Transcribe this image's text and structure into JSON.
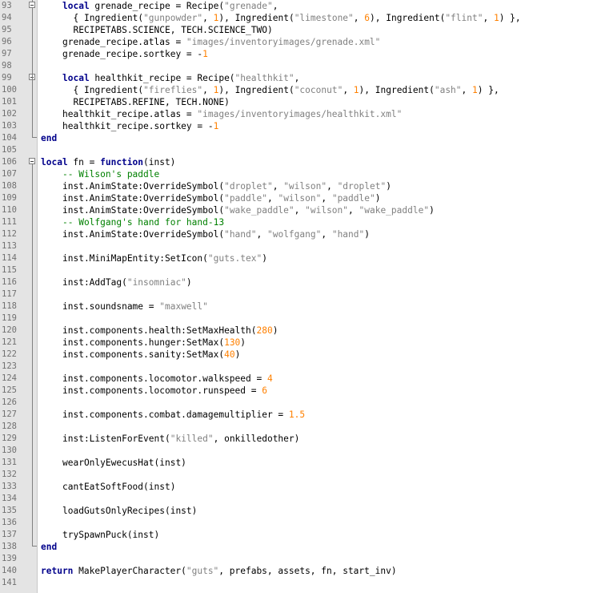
{
  "editor": {
    "colors": {
      "background": "#ffffff",
      "gutter": "#e4e4e4",
      "keyword": "#00008b",
      "string": "#808080",
      "number": "#ff8000",
      "comment": "#008000",
      "line_number": "#707070"
    },
    "fold_markers": [
      {
        "line": 93,
        "type": "start"
      },
      {
        "line": 99,
        "type": "start"
      },
      {
        "line": 104,
        "type": "end"
      },
      {
        "line": 106,
        "type": "start"
      },
      {
        "line": 138,
        "type": "end"
      }
    ],
    "lines": [
      {
        "n": "93",
        "tokens": [
          {
            "t": "kw",
            "v": "local"
          },
          {
            "t": "plain",
            "v": " grenade_recipe = Recipe("
          },
          {
            "t": "str",
            "v": "\"grenade\""
          },
          {
            "t": "plain",
            "v": ","
          }
        ],
        "indent": 2
      },
      {
        "n": "94",
        "tokens": [
          {
            "t": "plain",
            "v": "{ Ingredient("
          },
          {
            "t": "str",
            "v": "\"gunpowder\""
          },
          {
            "t": "plain",
            "v": ", "
          },
          {
            "t": "num",
            "v": "1"
          },
          {
            "t": "plain",
            "v": "), Ingredient("
          },
          {
            "t": "str",
            "v": "\"limestone\""
          },
          {
            "t": "plain",
            "v": ", "
          },
          {
            "t": "num",
            "v": "6"
          },
          {
            "t": "plain",
            "v": "), Ingredient("
          },
          {
            "t": "str",
            "v": "\"flint\""
          },
          {
            "t": "plain",
            "v": ", "
          },
          {
            "t": "num",
            "v": "1"
          },
          {
            "t": "plain",
            "v": ") },"
          }
        ],
        "indent": 3
      },
      {
        "n": "95",
        "tokens": [
          {
            "t": "plain",
            "v": "RECIPETABS.SCIENCE, TECH.SCIENCE_TWO)"
          }
        ],
        "indent": 3
      },
      {
        "n": "96",
        "tokens": [
          {
            "t": "plain",
            "v": "grenade_recipe.atlas = "
          },
          {
            "t": "str",
            "v": "\"images/inventoryimages/grenade.xml\""
          }
        ],
        "indent": 2
      },
      {
        "n": "97",
        "tokens": [
          {
            "t": "plain",
            "v": "grenade_recipe.sortkey = -"
          },
          {
            "t": "num",
            "v": "1"
          }
        ],
        "indent": 2
      },
      {
        "n": "98",
        "tokens": [],
        "indent": 0
      },
      {
        "n": "99",
        "tokens": [
          {
            "t": "kw",
            "v": "local"
          },
          {
            "t": "plain",
            "v": " healthkit_recipe = Recipe("
          },
          {
            "t": "str",
            "v": "\"healthkit\""
          },
          {
            "t": "plain",
            "v": ","
          }
        ],
        "indent": 2
      },
      {
        "n": "100",
        "tokens": [
          {
            "t": "plain",
            "v": "{ Ingredient("
          },
          {
            "t": "str",
            "v": "\"fireflies\""
          },
          {
            "t": "plain",
            "v": ", "
          },
          {
            "t": "num",
            "v": "1"
          },
          {
            "t": "plain",
            "v": "), Ingredient("
          },
          {
            "t": "str",
            "v": "\"coconut\""
          },
          {
            "t": "plain",
            "v": ", "
          },
          {
            "t": "num",
            "v": "1"
          },
          {
            "t": "plain",
            "v": "), Ingredient("
          },
          {
            "t": "str",
            "v": "\"ash\""
          },
          {
            "t": "plain",
            "v": ", "
          },
          {
            "t": "num",
            "v": "1"
          },
          {
            "t": "plain",
            "v": ") },"
          }
        ],
        "indent": 3
      },
      {
        "n": "101",
        "tokens": [
          {
            "t": "plain",
            "v": "RECIPETABS.REFINE, TECH.NONE)"
          }
        ],
        "indent": 3
      },
      {
        "n": "102",
        "tokens": [
          {
            "t": "plain",
            "v": "healthkit_recipe.atlas = "
          },
          {
            "t": "str",
            "v": "\"images/inventoryimages/healthkit.xml\""
          }
        ],
        "indent": 2
      },
      {
        "n": "103",
        "tokens": [
          {
            "t": "plain",
            "v": "healthkit_recipe.sortkey = -"
          },
          {
            "t": "num",
            "v": "1"
          }
        ],
        "indent": 2
      },
      {
        "n": "104",
        "tokens": [
          {
            "t": "kw",
            "v": "end"
          }
        ],
        "indent": 0
      },
      {
        "n": "105",
        "tokens": [],
        "indent": 0
      },
      {
        "n": "106",
        "tokens": [
          {
            "t": "kw",
            "v": "local"
          },
          {
            "t": "plain",
            "v": " fn = "
          },
          {
            "t": "kw",
            "v": "function"
          },
          {
            "t": "plain",
            "v": "(inst)"
          }
        ],
        "indent": 0
      },
      {
        "n": "107",
        "tokens": [
          {
            "t": "com",
            "v": "-- Wilson's paddle"
          }
        ],
        "indent": 2
      },
      {
        "n": "108",
        "tokens": [
          {
            "t": "plain",
            "v": "inst.AnimState:OverrideSymbol("
          },
          {
            "t": "str",
            "v": "\"droplet\""
          },
          {
            "t": "plain",
            "v": ", "
          },
          {
            "t": "str",
            "v": "\"wilson\""
          },
          {
            "t": "plain",
            "v": ", "
          },
          {
            "t": "str",
            "v": "\"droplet\""
          },
          {
            "t": "plain",
            "v": ")"
          }
        ],
        "indent": 2
      },
      {
        "n": "109",
        "tokens": [
          {
            "t": "plain",
            "v": "inst.AnimState:OverrideSymbol("
          },
          {
            "t": "str",
            "v": "\"paddle\""
          },
          {
            "t": "plain",
            "v": ", "
          },
          {
            "t": "str",
            "v": "\"wilson\""
          },
          {
            "t": "plain",
            "v": ", "
          },
          {
            "t": "str",
            "v": "\"paddle\""
          },
          {
            "t": "plain",
            "v": ")"
          }
        ],
        "indent": 2
      },
      {
        "n": "110",
        "tokens": [
          {
            "t": "plain",
            "v": "inst.AnimState:OverrideSymbol("
          },
          {
            "t": "str",
            "v": "\"wake_paddle\""
          },
          {
            "t": "plain",
            "v": ", "
          },
          {
            "t": "str",
            "v": "\"wilson\""
          },
          {
            "t": "plain",
            "v": ", "
          },
          {
            "t": "str",
            "v": "\"wake_paddle\""
          },
          {
            "t": "plain",
            "v": ")"
          }
        ],
        "indent": 2
      },
      {
        "n": "111",
        "tokens": [
          {
            "t": "com",
            "v": "-- Wolfgang's hand for hand-13"
          }
        ],
        "indent": 2
      },
      {
        "n": "112",
        "tokens": [
          {
            "t": "plain",
            "v": "inst.AnimState:OverrideSymbol("
          },
          {
            "t": "str",
            "v": "\"hand\""
          },
          {
            "t": "plain",
            "v": ", "
          },
          {
            "t": "str",
            "v": "\"wolfgang\""
          },
          {
            "t": "plain",
            "v": ", "
          },
          {
            "t": "str",
            "v": "\"hand\""
          },
          {
            "t": "plain",
            "v": ")"
          }
        ],
        "indent": 2
      },
      {
        "n": "113",
        "tokens": [],
        "indent": 0
      },
      {
        "n": "114",
        "tokens": [
          {
            "t": "plain",
            "v": "inst.MiniMapEntity:SetIcon("
          },
          {
            "t": "str",
            "v": "\"guts.tex\""
          },
          {
            "t": "plain",
            "v": ")"
          }
        ],
        "indent": 2
      },
      {
        "n": "115",
        "tokens": [],
        "indent": 0
      },
      {
        "n": "116",
        "tokens": [
          {
            "t": "plain",
            "v": "inst:AddTag("
          },
          {
            "t": "str",
            "v": "\"insomniac\""
          },
          {
            "t": "plain",
            "v": ")"
          }
        ],
        "indent": 2
      },
      {
        "n": "117",
        "tokens": [],
        "indent": 0
      },
      {
        "n": "118",
        "tokens": [
          {
            "t": "plain",
            "v": "inst.soundsname = "
          },
          {
            "t": "str",
            "v": "\"maxwell\""
          }
        ],
        "indent": 2
      },
      {
        "n": "119",
        "tokens": [],
        "indent": 0
      },
      {
        "n": "120",
        "tokens": [
          {
            "t": "plain",
            "v": "inst.components.health:SetMaxHealth("
          },
          {
            "t": "num",
            "v": "280"
          },
          {
            "t": "plain",
            "v": ")"
          }
        ],
        "indent": 2
      },
      {
        "n": "121",
        "tokens": [
          {
            "t": "plain",
            "v": "inst.components.hunger:SetMax("
          },
          {
            "t": "num",
            "v": "130"
          },
          {
            "t": "plain",
            "v": ")"
          }
        ],
        "indent": 2
      },
      {
        "n": "122",
        "tokens": [
          {
            "t": "plain",
            "v": "inst.components.sanity:SetMax("
          },
          {
            "t": "num",
            "v": "40"
          },
          {
            "t": "plain",
            "v": ")"
          }
        ],
        "indent": 2
      },
      {
        "n": "123",
        "tokens": [],
        "indent": 0
      },
      {
        "n": "124",
        "tokens": [
          {
            "t": "plain",
            "v": "inst.components.locomotor.walkspeed = "
          },
          {
            "t": "num",
            "v": "4"
          }
        ],
        "indent": 2
      },
      {
        "n": "125",
        "tokens": [
          {
            "t": "plain",
            "v": "inst.components.locomotor.runspeed = "
          },
          {
            "t": "num",
            "v": "6"
          }
        ],
        "indent": 2
      },
      {
        "n": "126",
        "tokens": [],
        "indent": 0
      },
      {
        "n": "127",
        "tokens": [
          {
            "t": "plain",
            "v": "inst.components.combat.damagemultiplier = "
          },
          {
            "t": "num",
            "v": "1.5"
          }
        ],
        "indent": 2
      },
      {
        "n": "128",
        "tokens": [],
        "indent": 0
      },
      {
        "n": "129",
        "tokens": [
          {
            "t": "plain",
            "v": "inst:ListenForEvent("
          },
          {
            "t": "str",
            "v": "\"killed\""
          },
          {
            "t": "plain",
            "v": ", onkilledother)"
          }
        ],
        "indent": 2
      },
      {
        "n": "130",
        "tokens": [],
        "indent": 0
      },
      {
        "n": "131",
        "tokens": [
          {
            "t": "plain",
            "v": "wearOnlyEwecusHat(inst)"
          }
        ],
        "indent": 2
      },
      {
        "n": "132",
        "tokens": [],
        "indent": 0
      },
      {
        "n": "133",
        "tokens": [
          {
            "t": "plain",
            "v": "cantEatSoftFood(inst)"
          }
        ],
        "indent": 2
      },
      {
        "n": "134",
        "tokens": [],
        "indent": 0
      },
      {
        "n": "135",
        "tokens": [
          {
            "t": "plain",
            "v": "loadGutsOnlyRecipes(inst)"
          }
        ],
        "indent": 2
      },
      {
        "n": "136",
        "tokens": [],
        "indent": 0
      },
      {
        "n": "137",
        "tokens": [
          {
            "t": "plain",
            "v": "trySpawnPuck(inst)"
          }
        ],
        "indent": 2
      },
      {
        "n": "138",
        "tokens": [
          {
            "t": "kw",
            "v": "end"
          }
        ],
        "indent": 0
      },
      {
        "n": "139",
        "tokens": [],
        "indent": 0
      },
      {
        "n": "140",
        "tokens": [
          {
            "t": "kw",
            "v": "return"
          },
          {
            "t": "plain",
            "v": " MakePlayerCharacter("
          },
          {
            "t": "str",
            "v": "\"guts\""
          },
          {
            "t": "plain",
            "v": ", prefabs, assets, fn, start_inv)"
          }
        ],
        "indent": 0
      },
      {
        "n": "141",
        "tokens": [],
        "indent": 0
      }
    ]
  }
}
